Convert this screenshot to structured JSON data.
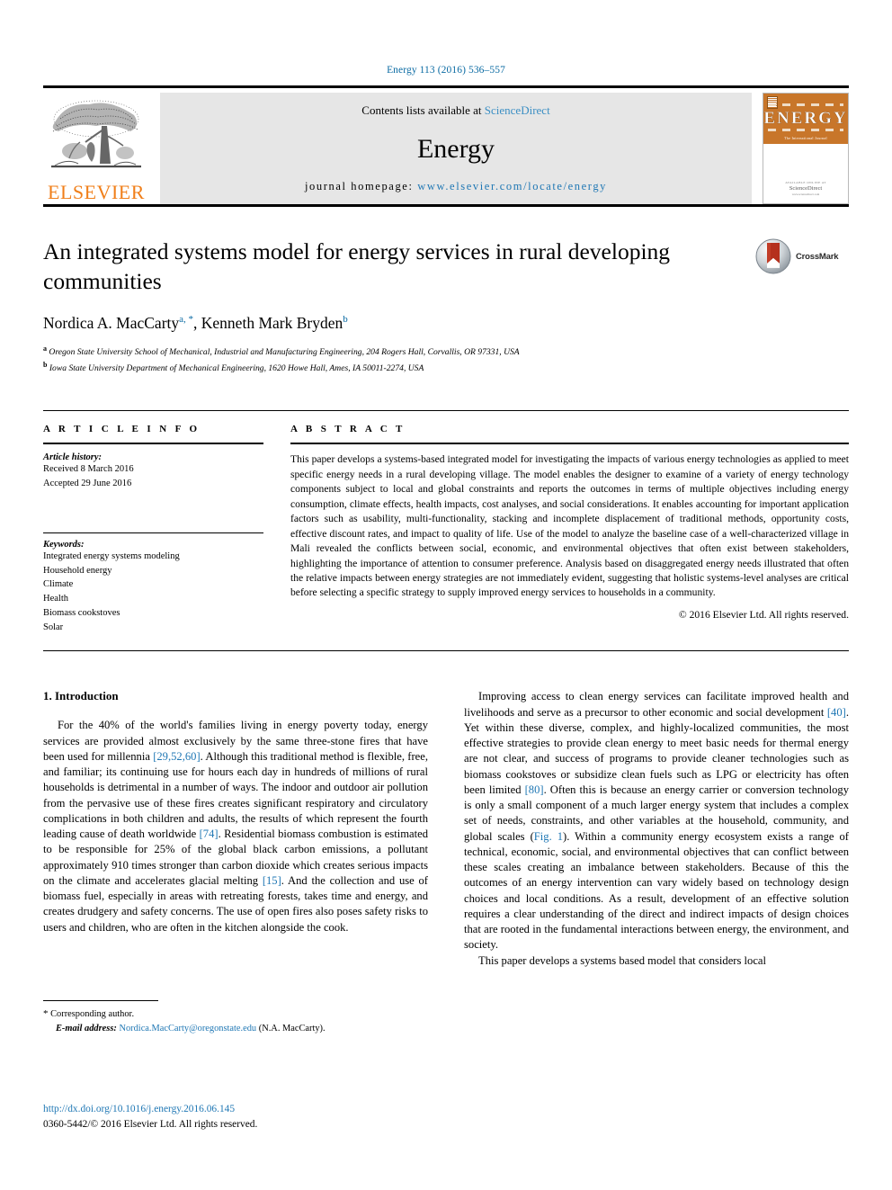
{
  "running_head": "Energy 113 (2016) 536–557",
  "masthead": {
    "publisher_name": "ELSEVIER",
    "contents_prefix": "Contents lists available at ",
    "contents_link": "ScienceDirect",
    "journal_name": "Energy",
    "homepage_prefix": "journal homepage: ",
    "homepage_url": "www.elsevier.com/locate/energy",
    "cover": {
      "title": "ENERGY",
      "subtitle": "The International Journal",
      "bottom_label": "AVAILABLE ONLINE AT",
      "bottom_brand": "ScienceDirect",
      "bottom_url": "www.sciencedirect.com"
    }
  },
  "article": {
    "title": "An integrated systems model for energy services in rural developing communities",
    "authors": "Nordica A. MacCarty , Kenneth Mark Bryden",
    "author_1": "Nordica A. MacCarty",
    "author_1_sup": "a, *",
    "author_sep": ", ",
    "author_2": "Kenneth Mark Bryden",
    "author_2_sup": "b",
    "affiliation_a_marker": "a",
    "affiliation_a": "Oregon State University School of Mechanical, Industrial and Manufacturing Engineering, 204 Rogers Hall, Corvallis, OR 97331, USA",
    "affiliation_b_marker": "b",
    "affiliation_b": "Iowa State University Department of Mechanical Engineering, 1620 Howe Hall, Ames, IA 50011-2274, USA",
    "crossmark_label": "CrossMark"
  },
  "article_info": {
    "heading": "A R T I C L E   I N F O",
    "history_label": "Article history:",
    "received": "Received 8 March 2016",
    "accepted": "Accepted 29 June 2016",
    "keywords_label": "Keywords:",
    "keywords": [
      "Integrated energy systems modeling",
      "Household energy",
      "Climate",
      "Health",
      "Biomass cookstoves",
      "Solar"
    ]
  },
  "abstract": {
    "heading": "A B S T R A C T",
    "text": "This paper develops a systems-based integrated model for investigating the impacts of various energy technologies as applied to meet specific energy needs in a rural developing village. The model enables the designer to examine of a variety of energy technology components subject to local and global constraints and reports the outcomes in terms of multiple objectives including energy consumption, climate effects, health impacts, cost analyses, and social considerations. It enables accounting for important application factors such as usability, multi-functionality, stacking and incomplete displacement of traditional methods, opportunity costs, effective discount rates, and impact to quality of life. Use of the model to analyze the baseline case of a well-characterized village in Mali revealed the conflicts between social, economic, and environmental objectives that often exist between stakeholders, highlighting the importance of attention to consumer preference. Analysis based on disaggregated energy needs illustrated that often the relative impacts between energy strategies are not immediately evident, suggesting that holistic systems-level analyses are critical before selecting a specific strategy to supply improved energy services to households in a community.",
    "copyright": "© 2016 Elsevier Ltd. All rights reserved."
  },
  "body": {
    "section_title": "1. Introduction",
    "left_para_1_a": "For the 40% of the world's families living in energy poverty today, energy services are provided almost exclusively by the same three-stone fires that have been used for millennia ",
    "left_para_1_ref_1": "[29,52,60]",
    "left_para_1_b": ". Although this traditional method is flexible, free, and familiar; its continuing use for hours each day in hundreds of millions of rural households is detrimental in a number of ways. The indoor and outdoor air pollution from the pervasive use of these fires creates significant respiratory and circulatory complications in both children and adults, the results of which represent the fourth leading cause of death worldwide ",
    "left_para_1_ref_2": "[74]",
    "left_para_1_c": ". Residential biomass combustion is estimated to be responsible for 25% of the global black carbon emissions, a pollutant approximately 910 times stronger than carbon dioxide which creates serious impacts on the climate and accelerates glacial melting ",
    "left_para_1_ref_3": "[15]",
    "left_para_1_d": ". And the collection and use of biomass fuel, especially in areas with retreating forests, takes time and energy, and creates drudgery and safety concerns. The use of open fires also poses safety risks to users and children, who are often in the kitchen alongside the cook.",
    "right_para_1_a": "Improving access to clean energy services can facilitate improved health and livelihoods and serve as a precursor to other economic and social development ",
    "right_para_1_ref_1": "[40]",
    "right_para_1_b": ". Yet within these diverse, complex, and highly-localized communities, the most effective strategies to provide clean energy to meet basic needs for thermal energy are not clear, and success of programs to provide cleaner technologies such as biomass cookstoves or subsidize clean fuels such as LPG or electricity has often been limited ",
    "right_para_1_ref_2": "[80]",
    "right_para_1_c": ". Often this is because an energy carrier or conversion technology is only a small component of a much larger energy system that includes a complex set of needs, constraints, and other variables at the household, community, and global scales (",
    "right_para_1_ref_3": "Fig. 1",
    "right_para_1_d": "). Within a community energy ecosystem exists a range of technical, economic, social, and environmental objectives that can conflict between these scales creating an imbalance between stakeholders. Because of this the outcomes of an energy intervention can vary widely based on technology design choices and local conditions. As a result, development of an effective solution requires a clear understanding of the direct and indirect impacts of design choices that are rooted in the fundamental interactions between energy, the environment, and society.",
    "right_para_2": "This paper develops a systems based model that considers local"
  },
  "footnote": {
    "star": "*",
    "corresponding": "Corresponding author.",
    "email_label": "E-mail address:",
    "email": "Nordica.MacCarty@oregonstate.edu",
    "email_suffix": "(N.A. MacCarty)."
  },
  "page_footer": {
    "doi": "http://dx.doi.org/10.1016/j.energy.2016.06.145",
    "issn": "0360-5442/© 2016 Elsevier Ltd. All rights reserved."
  },
  "colors": {
    "link_blue": "#1f77b4",
    "header_blue": "#0b6ba3",
    "elsevier_orange": "#f07f1a",
    "cover_orange": "#c8762a",
    "band_grey": "#e6e6e6"
  }
}
